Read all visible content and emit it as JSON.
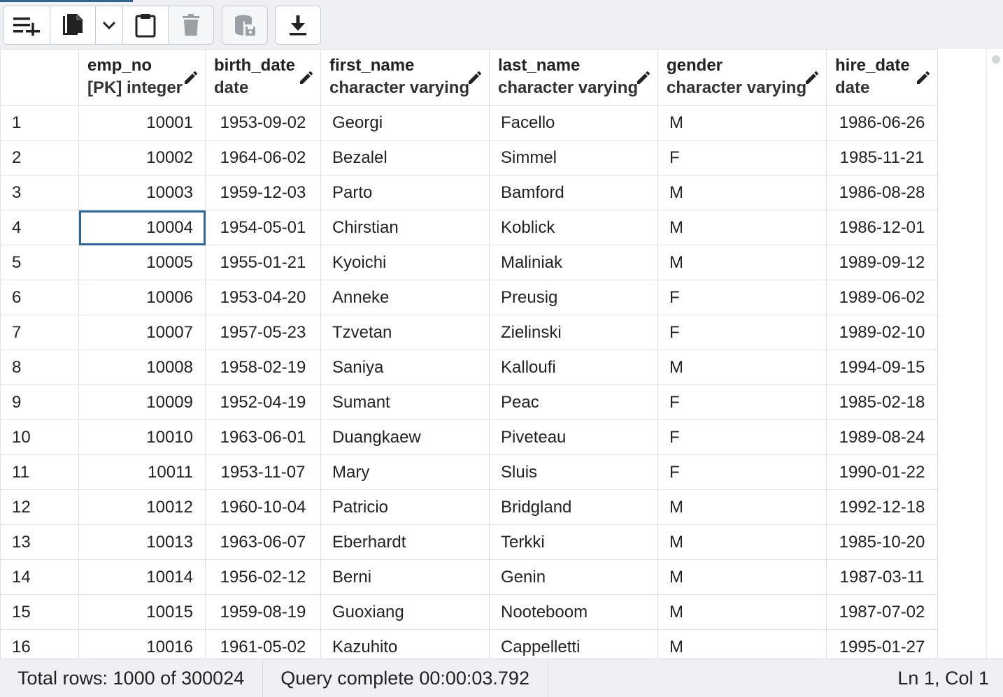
{
  "toolbar": {
    "buttons": [
      {
        "name": "add-row",
        "icon": "add-row-icon"
      },
      {
        "name": "copy",
        "icon": "copy-icon"
      },
      {
        "name": "copy-options",
        "icon": "chevron-down-icon"
      },
      {
        "name": "paste",
        "icon": "paste-icon"
      },
      {
        "name": "delete",
        "icon": "trash-icon"
      },
      {
        "name": "save-data",
        "icon": "database-save-icon"
      },
      {
        "name": "download",
        "icon": "download-icon"
      }
    ]
  },
  "grid": {
    "columns": [
      {
        "name": "emp_no",
        "type": "[PK] integer"
      },
      {
        "name": "birth_date",
        "type": "date"
      },
      {
        "name": "first_name",
        "type": "character varying"
      },
      {
        "name": "last_name",
        "type": "character varying"
      },
      {
        "name": "gender",
        "type": "character varying"
      },
      {
        "name": "hire_date",
        "type": "date"
      }
    ],
    "rows": [
      [
        "1",
        "10001",
        "1953-09-02",
        "Georgi",
        "Facello",
        "M",
        "1986-06-26"
      ],
      [
        "2",
        "10002",
        "1964-06-02",
        "Bezalel",
        "Simmel",
        "F",
        "1985-11-21"
      ],
      [
        "3",
        "10003",
        "1959-12-03",
        "Parto",
        "Bamford",
        "M",
        "1986-08-28"
      ],
      [
        "4",
        "10004",
        "1954-05-01",
        "Chirstian",
        "Koblick",
        "M",
        "1986-12-01"
      ],
      [
        "5",
        "10005",
        "1955-01-21",
        "Kyoichi",
        "Maliniak",
        "M",
        "1989-09-12"
      ],
      [
        "6",
        "10006",
        "1953-04-20",
        "Anneke",
        "Preusig",
        "F",
        "1989-06-02"
      ],
      [
        "7",
        "10007",
        "1957-05-23",
        "Tzvetan",
        "Zielinski",
        "F",
        "1989-02-10"
      ],
      [
        "8",
        "10008",
        "1958-02-19",
        "Saniya",
        "Kalloufi",
        "M",
        "1994-09-15"
      ],
      [
        "9",
        "10009",
        "1952-04-19",
        "Sumant",
        "Peac",
        "F",
        "1985-02-18"
      ],
      [
        "10",
        "10010",
        "1963-06-01",
        "Duangkaew",
        "Piveteau",
        "F",
        "1989-08-24"
      ],
      [
        "11",
        "10011",
        "1953-11-07",
        "Mary",
        "Sluis",
        "F",
        "1990-01-22"
      ],
      [
        "12",
        "10012",
        "1960-10-04",
        "Patricio",
        "Bridgland",
        "M",
        "1992-12-18"
      ],
      [
        "13",
        "10013",
        "1963-06-07",
        "Eberhardt",
        "Terkki",
        "M",
        "1985-10-20"
      ],
      [
        "14",
        "10014",
        "1956-02-12",
        "Berni",
        "Genin",
        "M",
        "1987-03-11"
      ],
      [
        "15",
        "10015",
        "1959-08-19",
        "Guoxiang",
        "Nooteboom",
        "M",
        "1987-07-02"
      ],
      [
        "16",
        "10016",
        "1961-05-02",
        "Kazuhito",
        "Cappelletti",
        "M",
        "1995-01-27"
      ]
    ],
    "selected_cell": {
      "row": 4,
      "column": "emp_no"
    }
  },
  "status": {
    "total_rows": "Total rows: 1000 of 300024",
    "query": "Query complete 00:00:03.792",
    "cursor": "Ln 1, Col 1"
  },
  "colors": {
    "accent": "#326690",
    "icon": "#222222",
    "icon_disabled": "#9aa0a6"
  }
}
